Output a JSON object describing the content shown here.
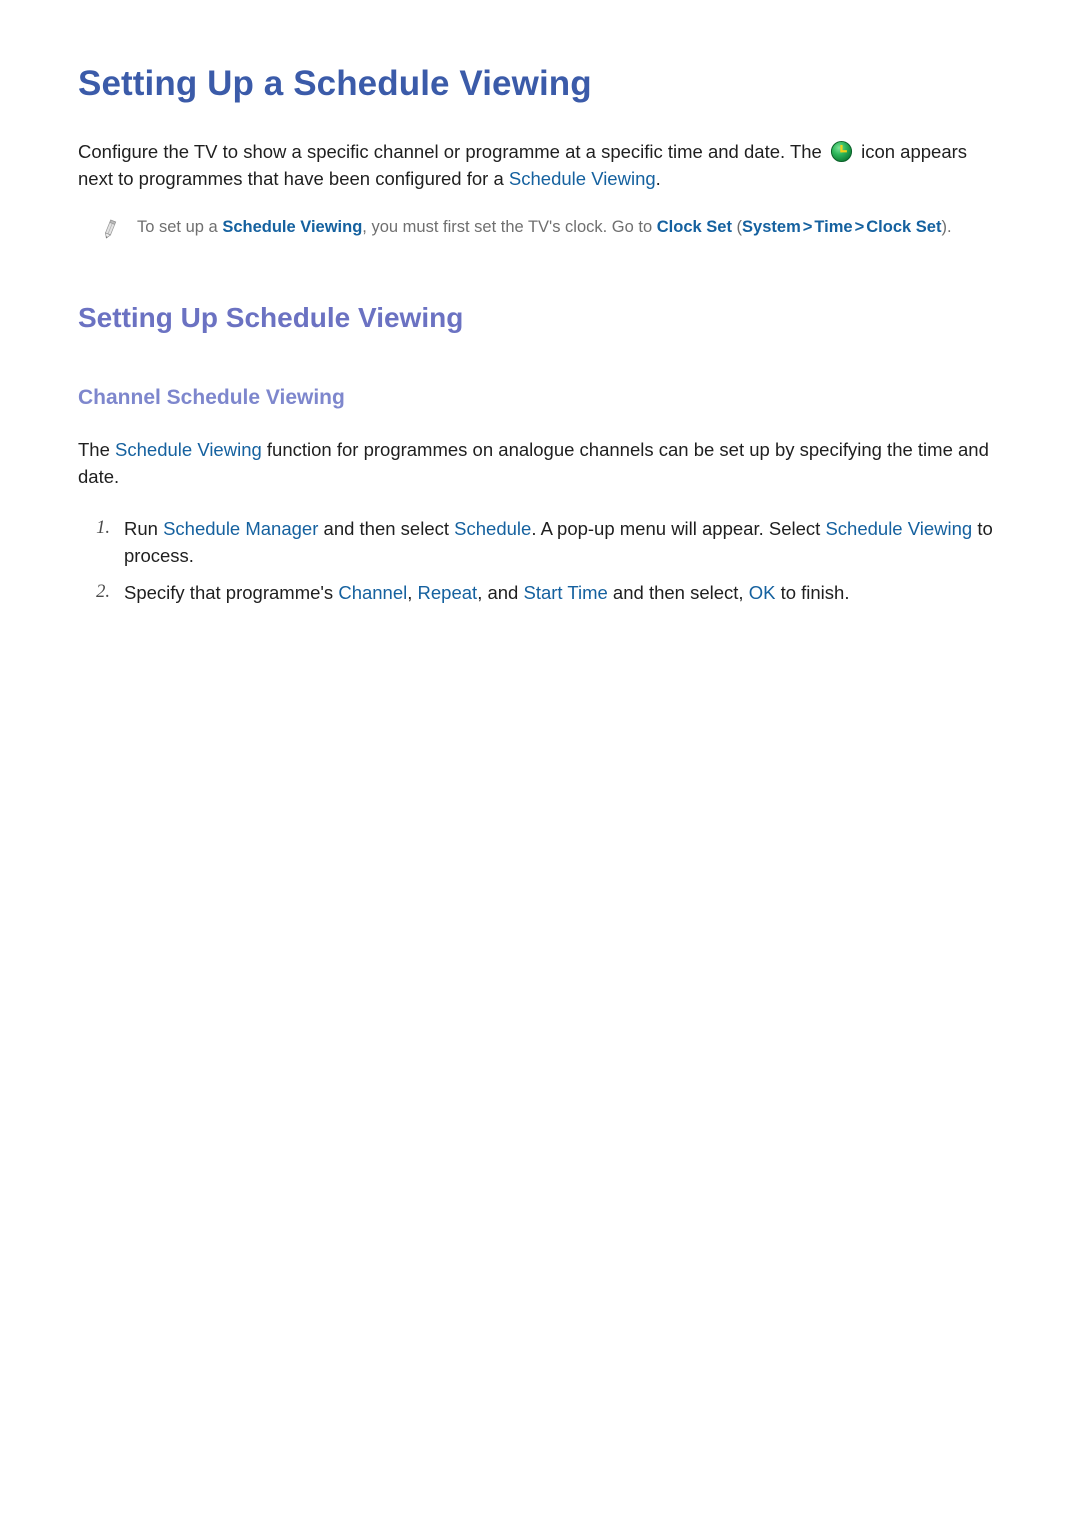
{
  "document": {
    "title": "Setting Up a Schedule Viewing",
    "intro": {
      "text_before_icon": "Configure the TV to show a specific channel or programme at a specific time and date. The ",
      "icon_name": "schedule-viewing-clock-icon",
      "text_after_icon": " icon appears next to programmes that have been configured for a ",
      "link": "Schedule Viewing",
      "text_end": "."
    },
    "note": {
      "icon_name": "pencil-note-icon",
      "part1": "To set up a ",
      "link1": "Schedule Viewing",
      "part2": ", you must first set the TV's clock. Go to ",
      "link2": "Clock Set",
      "part3": " (",
      "link3": "System",
      "sep1": ">",
      "link4": "Time",
      "sep2": ">",
      "link5": "Clock Set",
      "part4": ")."
    },
    "section": {
      "heading": "Setting Up Schedule Viewing",
      "subheading": "Channel Schedule Viewing",
      "description": {
        "part1": "The ",
        "link1": "Schedule Viewing",
        "part2": " function for programmes on analogue channels can be set up by specifying the time and date."
      },
      "steps": [
        {
          "number": "1.",
          "part1": "Run ",
          "link1": "Schedule Manager",
          "part2": " and then select ",
          "link2": "Schedule",
          "part3": ". A pop-up menu will appear. Select ",
          "link3": "Schedule Viewing",
          "part4": " to process."
        },
        {
          "number": "2.",
          "part1": "Specify that programme's ",
          "link1": "Channel",
          "part2": ", ",
          "link2": "Repeat",
          "part3": ", and ",
          "link3": "Start Time",
          "part4": " and then select, ",
          "link4": "OK",
          "part5": " to finish."
        }
      ]
    }
  },
  "colors": {
    "h1": "#3b5ba9",
    "h2": "#6b72c2",
    "h3": "#7e87cd",
    "link": "#15619f",
    "note_text": "#6f6f6f",
    "body_text": "#1f1f1f",
    "clock_icon_green": "#22a34a",
    "clock_icon_hand": "#f2d118",
    "background": "#ffffff"
  }
}
